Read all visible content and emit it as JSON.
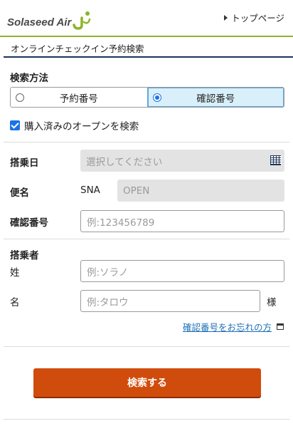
{
  "header": {
    "logo_text": "Solaseed Air",
    "top_link": "トップページ"
  },
  "page_title": "オンラインチェックイン予約検索",
  "search_method": {
    "label": "検索方法",
    "options": [
      "予約番号",
      "確認番号"
    ],
    "selected": "確認番号"
  },
  "open_search": {
    "label": "購入済みのオープンを検索",
    "checked": true
  },
  "boarding_date": {
    "label": "搭乗日",
    "placeholder": "選択してください"
  },
  "flight": {
    "label": "便名",
    "airline_code": "SNA",
    "value": "OPEN"
  },
  "confirmation": {
    "label": "確認番号",
    "placeholder": "例:123456789"
  },
  "passenger": {
    "label": "搭乗者",
    "last_name_label": "姓",
    "last_name_placeholder": "例:ソラノ",
    "first_name_label": "名",
    "first_name_placeholder": "例:タロウ",
    "honorific": "様"
  },
  "forgot_link": "確認番号をお忘れの方",
  "search_button": "検索する",
  "colors": {
    "brand_green": "#8db32a",
    "navy": "#1c3559",
    "button_orange": "#d04c0c",
    "selected_bg": "#d9f0fb",
    "link_blue": "#1d6fb8"
  },
  "icons": [
    "arrow-right-icon",
    "calendar-icon",
    "external-window-icon",
    "logo-swoosh-icon"
  ]
}
